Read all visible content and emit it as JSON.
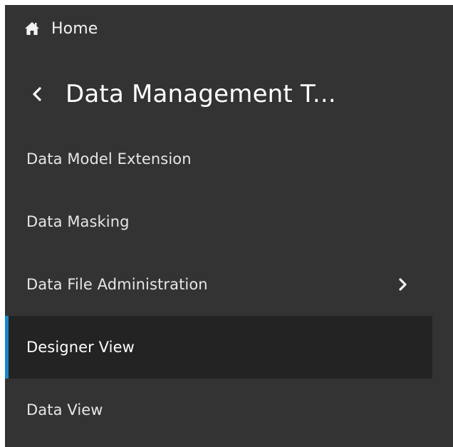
{
  "nav": {
    "home": {
      "icon": "home-icon",
      "label": "Home"
    },
    "back": {
      "icon": "chevron-left-icon",
      "title": "Data Management T..."
    },
    "items": [
      {
        "label": "Data Model Extension",
        "selected": false,
        "has_submenu": false
      },
      {
        "label": "Data Masking",
        "selected": false,
        "has_submenu": false
      },
      {
        "label": "Data File Administration",
        "selected": false,
        "has_submenu": true,
        "submenu_icon": "chevron-right-icon"
      },
      {
        "label": "Designer View",
        "selected": true,
        "has_submenu": false
      },
      {
        "label": "Data View",
        "selected": false,
        "has_submenu": false
      }
    ]
  },
  "colors": {
    "panel_background": "#333333",
    "selected_background": "#232323",
    "selected_indicator": "#1a86c8",
    "text": "#e6e6e6"
  }
}
